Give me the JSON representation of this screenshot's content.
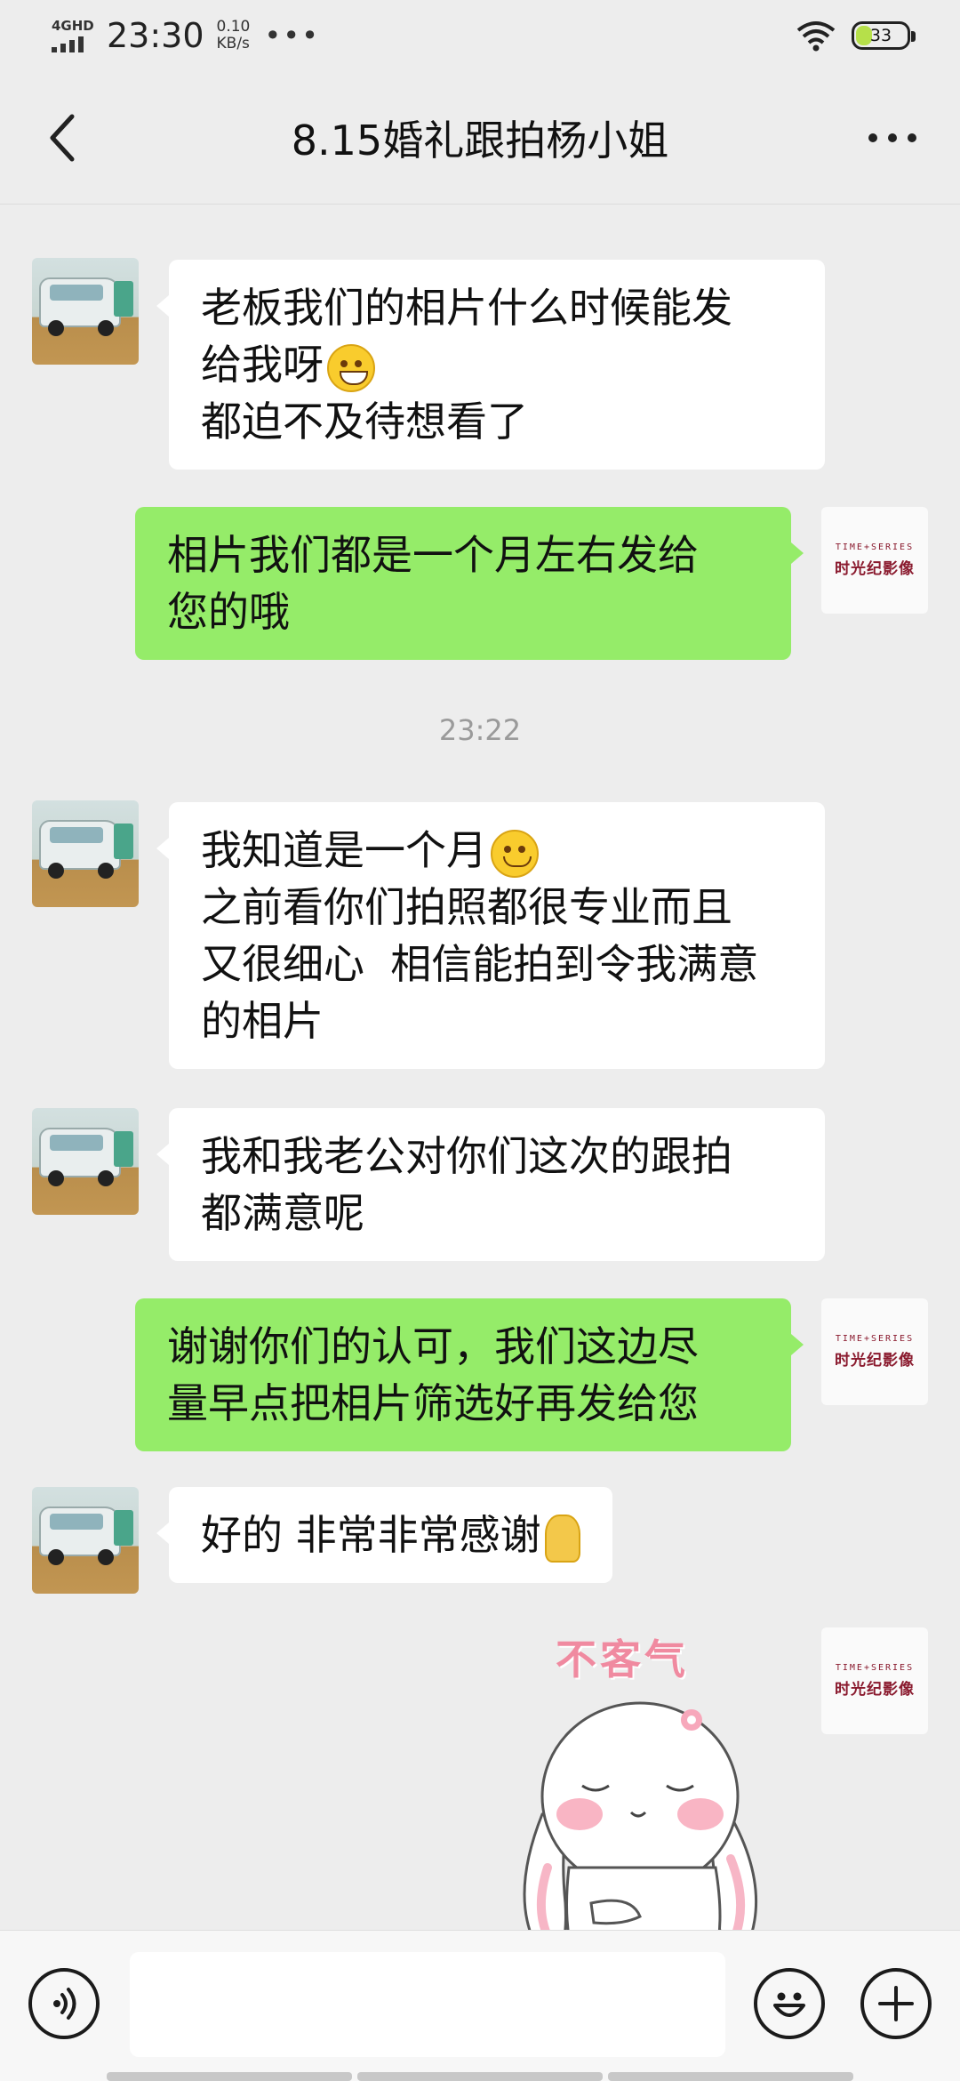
{
  "status_bar": {
    "network": "4GHD",
    "time": "23:30",
    "speed_value": "0.10",
    "speed_unit": "KB/s",
    "dots": "•••",
    "battery_level": "33"
  },
  "nav": {
    "title": "8.15婚礼跟拍杨小姐"
  },
  "shop_avatar": {
    "brand_top": "TIME+SERIES",
    "brand_cn": "时光纪影像"
  },
  "messages": [
    {
      "side": "in",
      "text": "老板我们的相片什么时候能发\n给我呀",
      "text2": "\n都迫不及待想看了",
      "emoji": "grin-icon"
    },
    {
      "side": "out",
      "text": "相片我们都是一个月左右发给\n您的哦"
    },
    {
      "side": "in",
      "text": "我知道是一个月",
      "text2": "\n之前看你们拍照都很专业而且\n又很细心  相信能拍到令我满意\n的相片",
      "emoji": "smile-icon"
    },
    {
      "side": "in",
      "text": "我和我老公对你们这次的跟拍\n都满意呢"
    },
    {
      "side": "out",
      "text": "谢谢你们的认可，我们这边尽\n量早点把相片筛选好再发给您"
    },
    {
      "side": "in",
      "text": "好的 非常非常感谢",
      "emoji": "pray-icon"
    }
  ],
  "timestamp": "23:22",
  "sticker": {
    "text": "不客气",
    "icon": "bunny-sticker"
  },
  "input_bar": {
    "placeholder": ""
  },
  "colors": {
    "background": "#ededed",
    "incoming_bubble": "#ffffff",
    "outgoing_bubble": "#95ec69",
    "brand": "#8a1a2e"
  }
}
